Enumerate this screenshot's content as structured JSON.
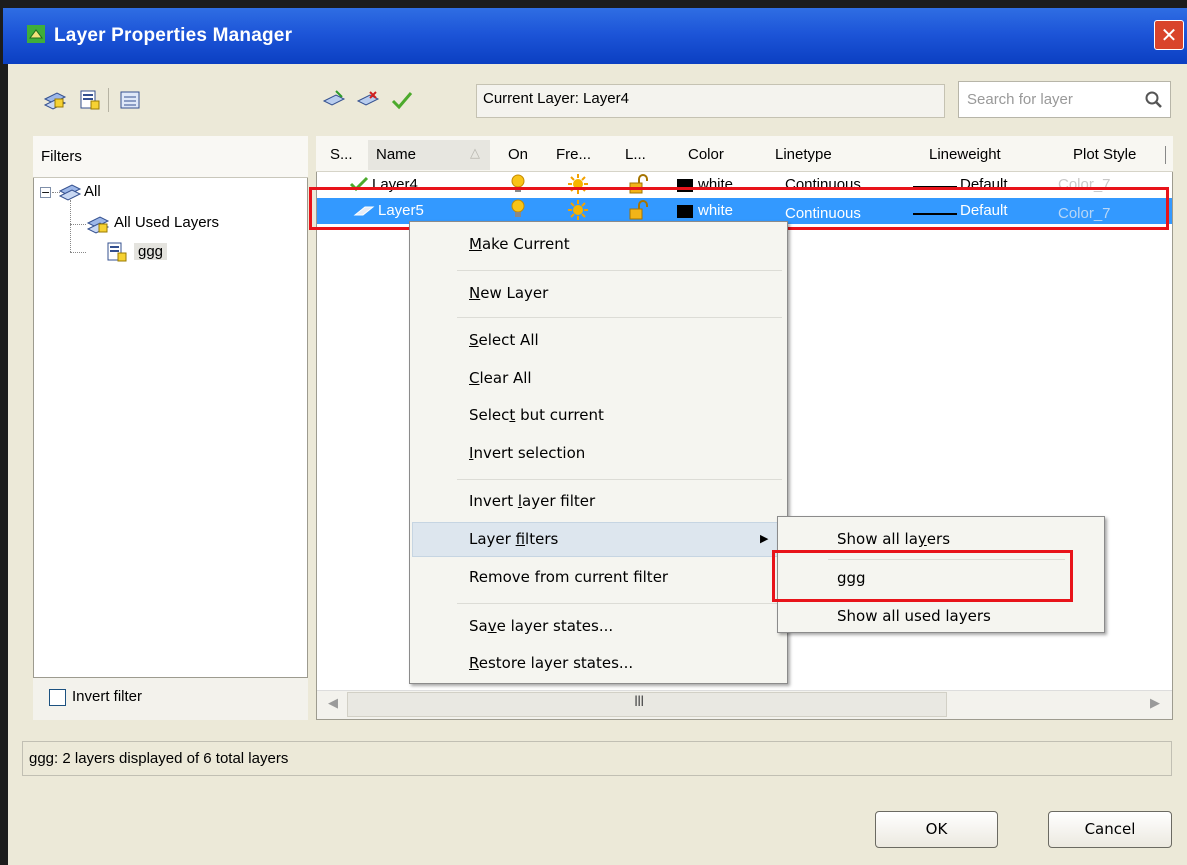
{
  "window": {
    "title": "Layer Properties Manager",
    "close": "✕"
  },
  "toolbar": {
    "current_layer": "Current Layer: Layer4",
    "search_placeholder": "Search for layer"
  },
  "filters": {
    "header": "Filters",
    "tree": {
      "root": "All",
      "children": [
        "All Used Layers",
        "ggg"
      ]
    },
    "invert_filter_label": "Invert filter"
  },
  "columns": [
    "S...",
    "Name",
    "On",
    "Fre...",
    "L...",
    "Color",
    "Linetype",
    "Lineweight",
    "Plot Style"
  ],
  "rows": [
    {
      "name": "Layer4",
      "color": "white",
      "linetype": "Continuous",
      "lineweight": "Default",
      "plot_style": "Color_7"
    },
    {
      "name": "Layer5",
      "color": "white",
      "linetype": "Continuous",
      "lineweight": "Default",
      "plot_style": "Color_7"
    }
  ],
  "hscroll_grip": "III",
  "context_menu": {
    "make_current": "Make Current",
    "new_layer": "New Layer",
    "select_all": "Select All",
    "clear_all": "Clear All",
    "select_but_current": "Select but current",
    "invert_selection": "Invert selection",
    "invert_layer_filter": "Invert layer filter",
    "layer_filters": "Layer filters",
    "remove_from_filter": "Remove from current filter",
    "save_states": "Save layer states...",
    "restore_states": "Restore layer states..."
  },
  "submenu": {
    "show_all": "Show all layers",
    "ggg": "ggg",
    "show_used": "Show all used layers"
  },
  "status": "ggg:  2 layers displayed of 6 total layers",
  "buttons": {
    "ok": "OK",
    "cancel": "Cancel"
  },
  "colors": {
    "title_bar": "#1d55d8",
    "selection": "#3399ff",
    "highlight_frame": "#e8131a",
    "dialog_bg": "#ece9d8"
  }
}
